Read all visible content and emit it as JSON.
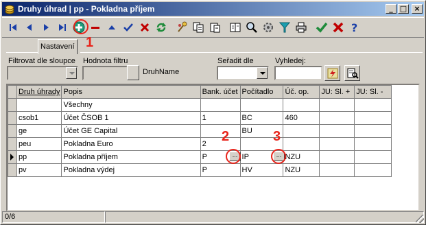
{
  "window": {
    "title": "Druhy úhrad | pp - Pokladna příjem",
    "minimize": "_",
    "maximize": "□",
    "close": "×"
  },
  "toolbar": {
    "buttons": [
      "first-icon",
      "prev-icon",
      "next-icon",
      "last-icon",
      "add-icon",
      "delete-icon",
      "up-icon",
      "confirm-icon",
      "cancel-icon",
      "refresh-icon",
      "tools-icon",
      "copy-icon",
      "paste-icon",
      "book-icon",
      "search-icon",
      "settings-icon",
      "filter-icon",
      "print-icon",
      "save-check-icon",
      "close-x-icon",
      "help-icon"
    ]
  },
  "tabs": {
    "active": "Nastavení"
  },
  "filters": {
    "filter_by_column_label": "Filtrovat dle sloupce",
    "filter_value_label": "Hodnota filtru",
    "filter_value_column": "DruhName",
    "sort_by_label": "Seřadit dle",
    "search_label": "Vyhledej:"
  },
  "grid": {
    "columns": [
      "Druh úhrady",
      "Popis",
      "Bank. účet",
      "Počítadlo",
      "Úč. op.",
      "JU: Sl. +",
      "JU: Sl. -"
    ],
    "rows": [
      [
        "",
        "Všechny",
        "",
        "",
        "",
        "",
        ""
      ],
      [
        "csob1",
        "Účet ČSOB 1",
        "1",
        "BC",
        "460",
        "",
        ""
      ],
      [
        "ge",
        "Účet GE Capital",
        "",
        "BU",
        "",
        "",
        ""
      ],
      [
        "peu",
        "Pokladna Euro",
        "2",
        "",
        "",
        "",
        ""
      ],
      [
        "pp",
        "Pokladna příjem",
        "P",
        "IP",
        "NZU",
        "",
        ""
      ],
      [
        "pv",
        "Pokladna výdej",
        "P",
        "HV",
        "NZU",
        "",
        ""
      ]
    ],
    "current_row": 4,
    "ellipsis": "..."
  },
  "callouts": [
    "1",
    "2",
    "3"
  ],
  "status": {
    "record": "0/6"
  },
  "colors": {
    "title_start": "#0a246a",
    "title_end": "#a6caf0",
    "callout": "#e8231a"
  }
}
